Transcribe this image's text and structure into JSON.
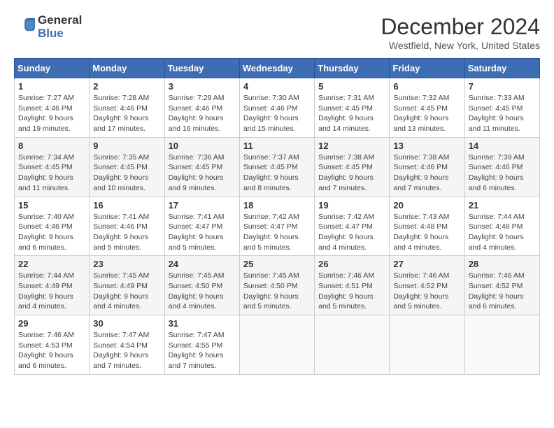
{
  "header": {
    "logo_line1": "General",
    "logo_line2": "Blue",
    "month_title": "December 2024",
    "location": "Westfield, New York, United States"
  },
  "days_of_week": [
    "Sunday",
    "Monday",
    "Tuesday",
    "Wednesday",
    "Thursday",
    "Friday",
    "Saturday"
  ],
  "weeks": [
    [
      {
        "day": "1",
        "sunrise": "7:27 AM",
        "sunset": "4:46 PM",
        "daylight": "9 hours and 19 minutes."
      },
      {
        "day": "2",
        "sunrise": "7:28 AM",
        "sunset": "4:46 PM",
        "daylight": "9 hours and 17 minutes."
      },
      {
        "day": "3",
        "sunrise": "7:29 AM",
        "sunset": "4:46 PM",
        "daylight": "9 hours and 16 minutes."
      },
      {
        "day": "4",
        "sunrise": "7:30 AM",
        "sunset": "4:46 PM",
        "daylight": "9 hours and 15 minutes."
      },
      {
        "day": "5",
        "sunrise": "7:31 AM",
        "sunset": "4:45 PM",
        "daylight": "9 hours and 14 minutes."
      },
      {
        "day": "6",
        "sunrise": "7:32 AM",
        "sunset": "4:45 PM",
        "daylight": "9 hours and 13 minutes."
      },
      {
        "day": "7",
        "sunrise": "7:33 AM",
        "sunset": "4:45 PM",
        "daylight": "9 hours and 11 minutes."
      }
    ],
    [
      {
        "day": "8",
        "sunrise": "7:34 AM",
        "sunset": "4:45 PM",
        "daylight": "9 hours and 11 minutes."
      },
      {
        "day": "9",
        "sunrise": "7:35 AM",
        "sunset": "4:45 PM",
        "daylight": "9 hours and 10 minutes."
      },
      {
        "day": "10",
        "sunrise": "7:36 AM",
        "sunset": "4:45 PM",
        "daylight": "9 hours and 9 minutes."
      },
      {
        "day": "11",
        "sunrise": "7:37 AM",
        "sunset": "4:45 PM",
        "daylight": "9 hours and 8 minutes."
      },
      {
        "day": "12",
        "sunrise": "7:38 AM",
        "sunset": "4:45 PM",
        "daylight": "9 hours and 7 minutes."
      },
      {
        "day": "13",
        "sunrise": "7:38 AM",
        "sunset": "4:46 PM",
        "daylight": "9 hours and 7 minutes."
      },
      {
        "day": "14",
        "sunrise": "7:39 AM",
        "sunset": "4:46 PM",
        "daylight": "9 hours and 6 minutes."
      }
    ],
    [
      {
        "day": "15",
        "sunrise": "7:40 AM",
        "sunset": "4:46 PM",
        "daylight": "9 hours and 6 minutes."
      },
      {
        "day": "16",
        "sunrise": "7:41 AM",
        "sunset": "4:46 PM",
        "daylight": "9 hours and 5 minutes."
      },
      {
        "day": "17",
        "sunrise": "7:41 AM",
        "sunset": "4:47 PM",
        "daylight": "9 hours and 5 minutes."
      },
      {
        "day": "18",
        "sunrise": "7:42 AM",
        "sunset": "4:47 PM",
        "daylight": "9 hours and 5 minutes."
      },
      {
        "day": "19",
        "sunrise": "7:42 AM",
        "sunset": "4:47 PM",
        "daylight": "9 hours and 4 minutes."
      },
      {
        "day": "20",
        "sunrise": "7:43 AM",
        "sunset": "4:48 PM",
        "daylight": "9 hours and 4 minutes."
      },
      {
        "day": "21",
        "sunrise": "7:44 AM",
        "sunset": "4:48 PM",
        "daylight": "9 hours and 4 minutes."
      }
    ],
    [
      {
        "day": "22",
        "sunrise": "7:44 AM",
        "sunset": "4:49 PM",
        "daylight": "9 hours and 4 minutes."
      },
      {
        "day": "23",
        "sunrise": "7:45 AM",
        "sunset": "4:49 PM",
        "daylight": "9 hours and 4 minutes."
      },
      {
        "day": "24",
        "sunrise": "7:45 AM",
        "sunset": "4:50 PM",
        "daylight": "9 hours and 4 minutes."
      },
      {
        "day": "25",
        "sunrise": "7:45 AM",
        "sunset": "4:50 PM",
        "daylight": "9 hours and 5 minutes."
      },
      {
        "day": "26",
        "sunrise": "7:46 AM",
        "sunset": "4:51 PM",
        "daylight": "9 hours and 5 minutes."
      },
      {
        "day": "27",
        "sunrise": "7:46 AM",
        "sunset": "4:52 PM",
        "daylight": "9 hours and 5 minutes."
      },
      {
        "day": "28",
        "sunrise": "7:46 AM",
        "sunset": "4:52 PM",
        "daylight": "9 hours and 6 minutes."
      }
    ],
    [
      {
        "day": "29",
        "sunrise": "7:46 AM",
        "sunset": "4:53 PM",
        "daylight": "9 hours and 6 minutes."
      },
      {
        "day": "30",
        "sunrise": "7:47 AM",
        "sunset": "4:54 PM",
        "daylight": "9 hours and 7 minutes."
      },
      {
        "day": "31",
        "sunrise": "7:47 AM",
        "sunset": "4:55 PM",
        "daylight": "9 hours and 7 minutes."
      },
      null,
      null,
      null,
      null
    ]
  ],
  "labels": {
    "sunrise": "Sunrise:",
    "sunset": "Sunset:",
    "daylight": "Daylight:"
  }
}
